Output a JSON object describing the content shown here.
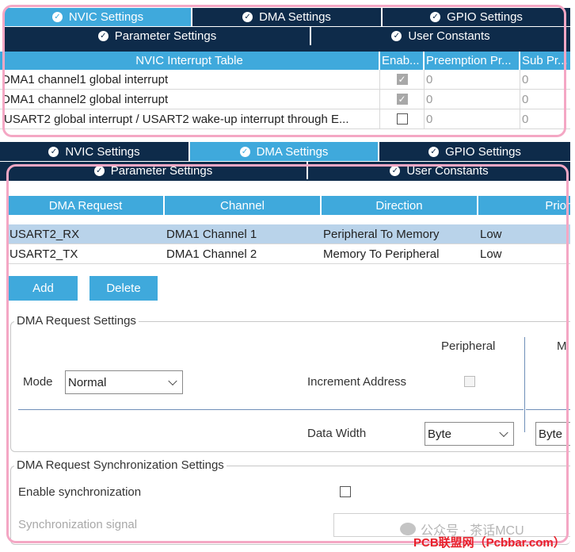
{
  "top_panel": {
    "tabs": [
      {
        "label": "NVIC Settings",
        "active": true
      },
      {
        "label": "DMA Settings",
        "active": false
      },
      {
        "label": "GPIO Settings",
        "active": false
      }
    ],
    "subtabs": [
      {
        "label": "Parameter Settings"
      },
      {
        "label": "User Constants"
      }
    ],
    "table": {
      "headers": [
        "NVIC Interrupt Table",
        "Enab...",
        "Preemption Pr...",
        "Sub Pr..."
      ],
      "rows": [
        {
          "name": "DMA1 channel1 global interrupt",
          "enabled": true,
          "preemption": "0",
          "sub": "0"
        },
        {
          "name": "DMA1 channel2 global interrupt",
          "enabled": true,
          "preemption": "0",
          "sub": "0"
        },
        {
          "name": "USART2 global interrupt / USART2 wake-up interrupt through E...",
          "enabled": false,
          "preemption": "0",
          "sub": "0"
        }
      ]
    }
  },
  "bottom_panel": {
    "tabs": [
      {
        "label": "NVIC Settings",
        "active": false
      },
      {
        "label": "DMA Settings",
        "active": true
      },
      {
        "label": "GPIO Settings",
        "active": false
      }
    ],
    "subtabs": [
      {
        "label": "Parameter Settings"
      },
      {
        "label": "User Constants"
      }
    ],
    "dma_table": {
      "headers": [
        "DMA Request",
        "Channel",
        "Direction",
        "Prior"
      ],
      "rows": [
        {
          "request": "USART2_RX",
          "channel": "DMA1 Channel 1",
          "direction": "Peripheral To Memory",
          "priority": "Low",
          "selected": true
        },
        {
          "request": "USART2_TX",
          "channel": "DMA1 Channel 2",
          "direction": "Memory To Peripheral",
          "priority": "Low",
          "selected": false
        }
      ]
    },
    "buttons": {
      "add": "Add",
      "delete": "Delete"
    },
    "request_settings": {
      "legend": "DMA Request Settings",
      "col_peripheral": "Peripheral",
      "col_memory": "M",
      "mode_label": "Mode",
      "mode_value": "Normal",
      "increment_label": "Increment Address",
      "data_width_label": "Data Width",
      "data_width_peripheral": "Byte",
      "data_width_memory": "Byte"
    },
    "sync_settings": {
      "legend": "DMA Request Synchronization Settings",
      "enable_label": "Enable synchronization",
      "signal_label": "Synchronization signal"
    }
  },
  "watermark": {
    "channel": "公众号 · 茶话MCU",
    "site": "PCB联盟网（Pcbbar.com）"
  },
  "colors": {
    "tab_dark": "#0e2b4a",
    "tab_active": "#3fa9dc",
    "header": "#3fa9dc",
    "highlight": "#f4a7c4",
    "watermark_red": "#e8202a"
  }
}
